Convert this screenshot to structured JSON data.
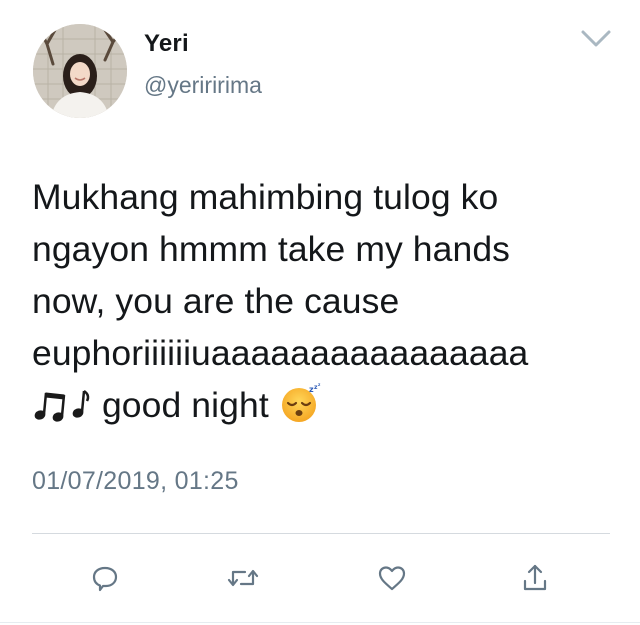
{
  "tweet": {
    "author": {
      "display_name": "Yeri",
      "handle": "@yeriririma"
    },
    "text_lines": [
      "Mukhang mahimbing tulog ko",
      "ngayon hmmm take my hands",
      "now, you are the cause",
      "euphoriiiiiiuaaaaaaaaaaaaaaaa",
      "good night"
    ],
    "text_emojis": [
      "music-notes-emoji",
      "sleeping-face-emoji"
    ],
    "timestamp": "01/07/2019, 01:25"
  },
  "actions": [
    {
      "name": "reply",
      "icon": "reply-icon"
    },
    {
      "name": "retweet",
      "icon": "retweet-icon"
    },
    {
      "name": "like",
      "icon": "heart-icon"
    },
    {
      "name": "share",
      "icon": "share-icon"
    }
  ],
  "colors": {
    "text_primary": "#14171a",
    "text_secondary": "#657786",
    "divider": "#d5dadf",
    "icon": "#657786"
  }
}
